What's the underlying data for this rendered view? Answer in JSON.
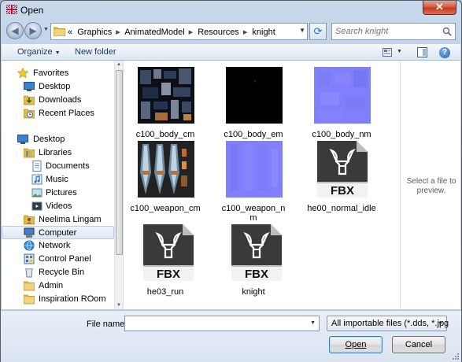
{
  "window": {
    "title": "Open",
    "close_label": "✕"
  },
  "address": {
    "crumb_prefix": "«",
    "crumbs": [
      "Graphics",
      "AnimatedModel",
      "Resources",
      "knight"
    ]
  },
  "search": {
    "placeholder": "Search knight"
  },
  "toolbar": {
    "organize_label": "Organize",
    "new_folder_label": "New folder",
    "help_label": "?"
  },
  "nav": {
    "items": [
      {
        "label": "Favorites",
        "icon": "star-icon"
      },
      {
        "label": "Desktop",
        "icon": "desktop-icon"
      },
      {
        "label": "Downloads",
        "icon": "downloads-icon"
      },
      {
        "label": "Recent Places",
        "icon": "recent-places-icon"
      },
      {
        "label": "Desktop",
        "icon": "desktop-icon"
      },
      {
        "label": "Libraries",
        "icon": "libraries-icon"
      },
      {
        "label": "Documents",
        "icon": "documents-icon"
      },
      {
        "label": "Music",
        "icon": "music-icon"
      },
      {
        "label": "Pictures",
        "icon": "pictures-icon"
      },
      {
        "label": "Videos",
        "icon": "videos-icon"
      },
      {
        "label": "Neelima Lingam",
        "icon": "user-folder-icon"
      },
      {
        "label": "Computer",
        "icon": "computer-icon"
      },
      {
        "label": "Network",
        "icon": "network-icon"
      },
      {
        "label": "Control Panel",
        "icon": "control-panel-icon"
      },
      {
        "label": "Recycle Bin",
        "icon": "recycle-bin-icon"
      },
      {
        "label": "Admin",
        "icon": "folder-icon"
      },
      {
        "label": "Inspiration ROom",
        "icon": "folder-icon"
      }
    ],
    "selected": "Computer"
  },
  "files": [
    {
      "name": "c100_body_cm",
      "kind": "texture-diffuse"
    },
    {
      "name": "c100_body_em",
      "kind": "texture-emissive"
    },
    {
      "name": "c100_body_nm",
      "kind": "texture-normal"
    },
    {
      "name": "c100_weapon_cm",
      "kind": "texture-weapon"
    },
    {
      "name": "c100_weapon_n",
      "name2": "m",
      "kind": "texture-normal"
    },
    {
      "name": "he00_normal_idle",
      "kind": "fbx"
    },
    {
      "name": "he03_run",
      "kind": "fbx"
    },
    {
      "name": "knight",
      "kind": "fbx"
    }
  ],
  "fbx_badge": "FBX",
  "preview": {
    "text": "Select a file to preview."
  },
  "bottom": {
    "file_name_label": "File name:",
    "file_name_value": "",
    "filter_label": "All importable files (*.dds, *.jpg",
    "open_label": "Open",
    "cancel_label": "Cancel"
  },
  "colors": {
    "accent": "#1e395b",
    "normal_map": "#8080ff",
    "fbx_dark": "#3a3a3a",
    "close_red": "#c2381f"
  }
}
